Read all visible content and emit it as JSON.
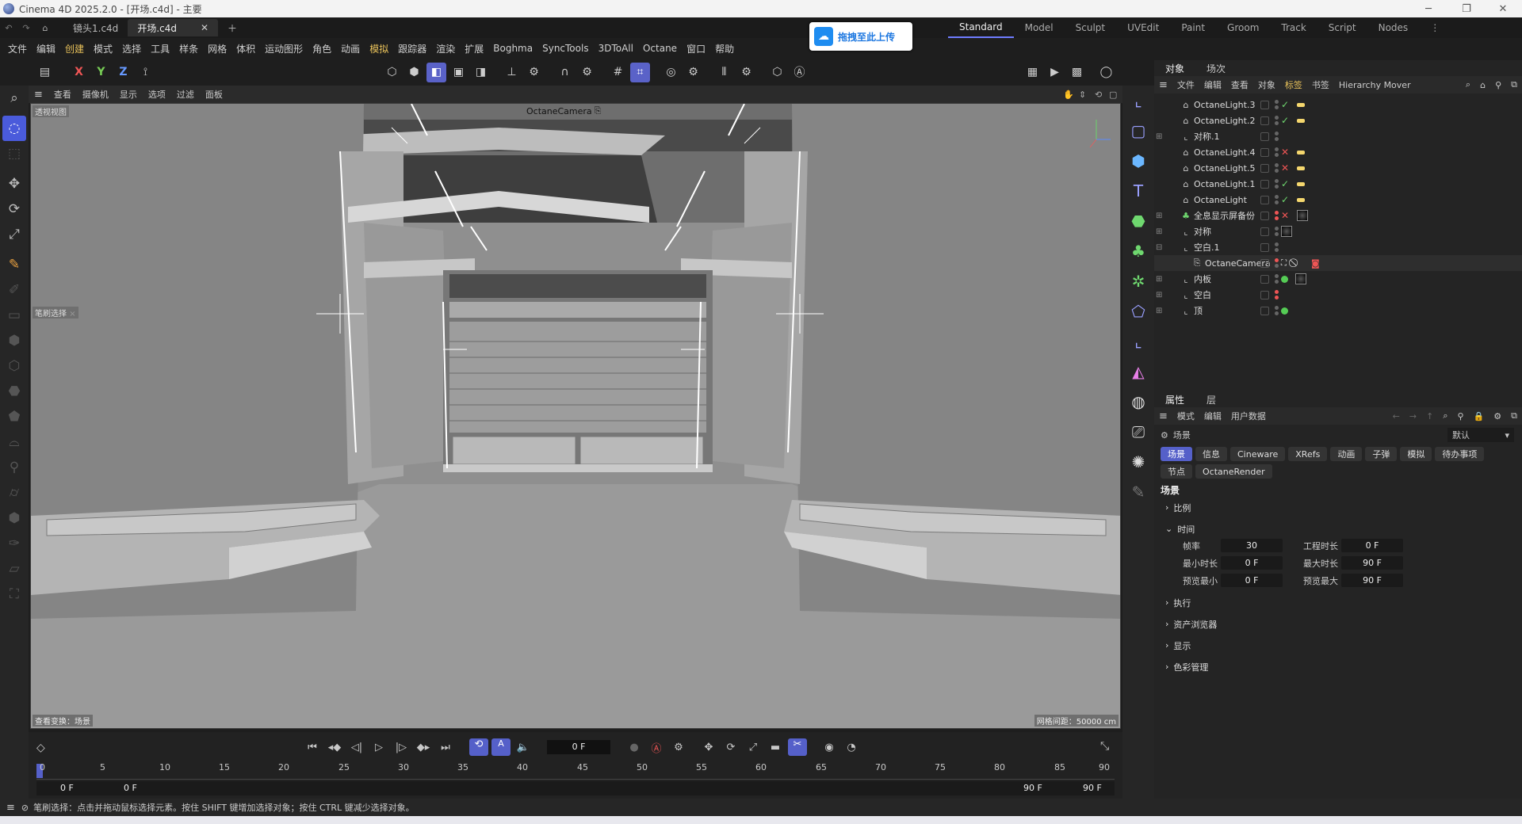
{
  "window": {
    "title": "Cinema 4D 2025.2.0 - [开场.c4d] - 主要"
  },
  "tabs": [
    {
      "label": "镜头1.c4d"
    },
    {
      "label": "开场.c4d"
    }
  ],
  "upload_button": "拖拽至此上传",
  "layouts": [
    "Standard",
    "Model",
    "Sculpt",
    "UVEdit",
    "Paint",
    "Groom",
    "Track",
    "Script",
    "Nodes"
  ],
  "menu": [
    "文件",
    "编辑",
    "创建",
    "模式",
    "选择",
    "工具",
    "样条",
    "网格",
    "体积",
    "运动图形",
    "角色",
    "动画",
    "模拟",
    "跟踪器",
    "渲染",
    "扩展",
    "Boghma",
    "SyncTools",
    "3DToAll",
    "Octane",
    "窗口",
    "帮助"
  ],
  "axis": {
    "x": "X",
    "y": "Y",
    "z": "Z"
  },
  "viewport": {
    "menu": [
      "查看",
      "摄像机",
      "显示",
      "选项",
      "过滤",
      "面板"
    ],
    "label": "透视视图",
    "camera": "OctaneCamera",
    "selection_label": "笔刷选择",
    "bottom_left": "查看变换：场景",
    "bottom_right": "网格间距：50000 cm"
  },
  "timeline": {
    "current_frame": "0 F",
    "ticks": [
      "0",
      "5",
      "10",
      "15",
      "20",
      "25",
      "30",
      "35",
      "40",
      "45",
      "50",
      "55",
      "60",
      "65",
      "70",
      "75",
      "80",
      "85",
      "90"
    ],
    "start": "0 F",
    "start2": "0 F",
    "end": "90 F",
    "end2": "90 F"
  },
  "objects_panel": {
    "tabs": [
      "对象",
      "场次"
    ],
    "menu": [
      "文件",
      "编辑",
      "查看",
      "对象",
      "标签",
      "书签",
      "Hierarchy Mover"
    ],
    "rows": [
      {
        "name": "OctaneLight.3",
        "status": "check"
      },
      {
        "name": "OctaneLight.2",
        "status": "check"
      },
      {
        "name": "对称.1",
        "status": ""
      },
      {
        "name": "OctaneLight.4",
        "status": "cross"
      },
      {
        "name": "OctaneLight.5",
        "status": "cross"
      },
      {
        "name": "OctaneLight.1",
        "status": "check"
      },
      {
        "name": "OctaneLight",
        "status": "check"
      },
      {
        "name": "全息显示屏备份",
        "status": "cross"
      },
      {
        "name": "对称",
        "status": ""
      },
      {
        "name": "空白.1",
        "status": ""
      },
      {
        "name": "OctaneCamera",
        "status": ""
      },
      {
        "name": "内板",
        "status": ""
      },
      {
        "name": "空白",
        "status": ""
      },
      {
        "name": "顶",
        "status": ""
      }
    ]
  },
  "attributes_panel": {
    "tabs": [
      "属性",
      "层"
    ],
    "menu": [
      "模式",
      "编辑",
      "用户数据"
    ],
    "mode": "场景",
    "preset": "默认",
    "chips": [
      "场景",
      "信息",
      "Cineware",
      "XRefs",
      "动画",
      "子弹",
      "模拟",
      "待办事项",
      "节点",
      "OctaneRender"
    ],
    "section_title": "场景",
    "groups": [
      "比例",
      "时间",
      "执行",
      "资产浏览器",
      "显示",
      "色彩管理"
    ],
    "fields": {
      "fps_label": "帧率",
      "fps": "30",
      "duration_label": "工程时长",
      "duration": "0 F",
      "min_label": "最小时长",
      "min": "0 F",
      "max_label": "最大时长",
      "max": "90 F",
      "pmin_label": "预览最小",
      "pmin": "0 F",
      "pmax_label": "预览最大",
      "pmax": "90 F"
    }
  },
  "status_bar": "笔刷选择：点击并拖动鼠标选择元素。按住 SHIFT 键增加选择对象；按住 CTRL 键减少选择对象。"
}
